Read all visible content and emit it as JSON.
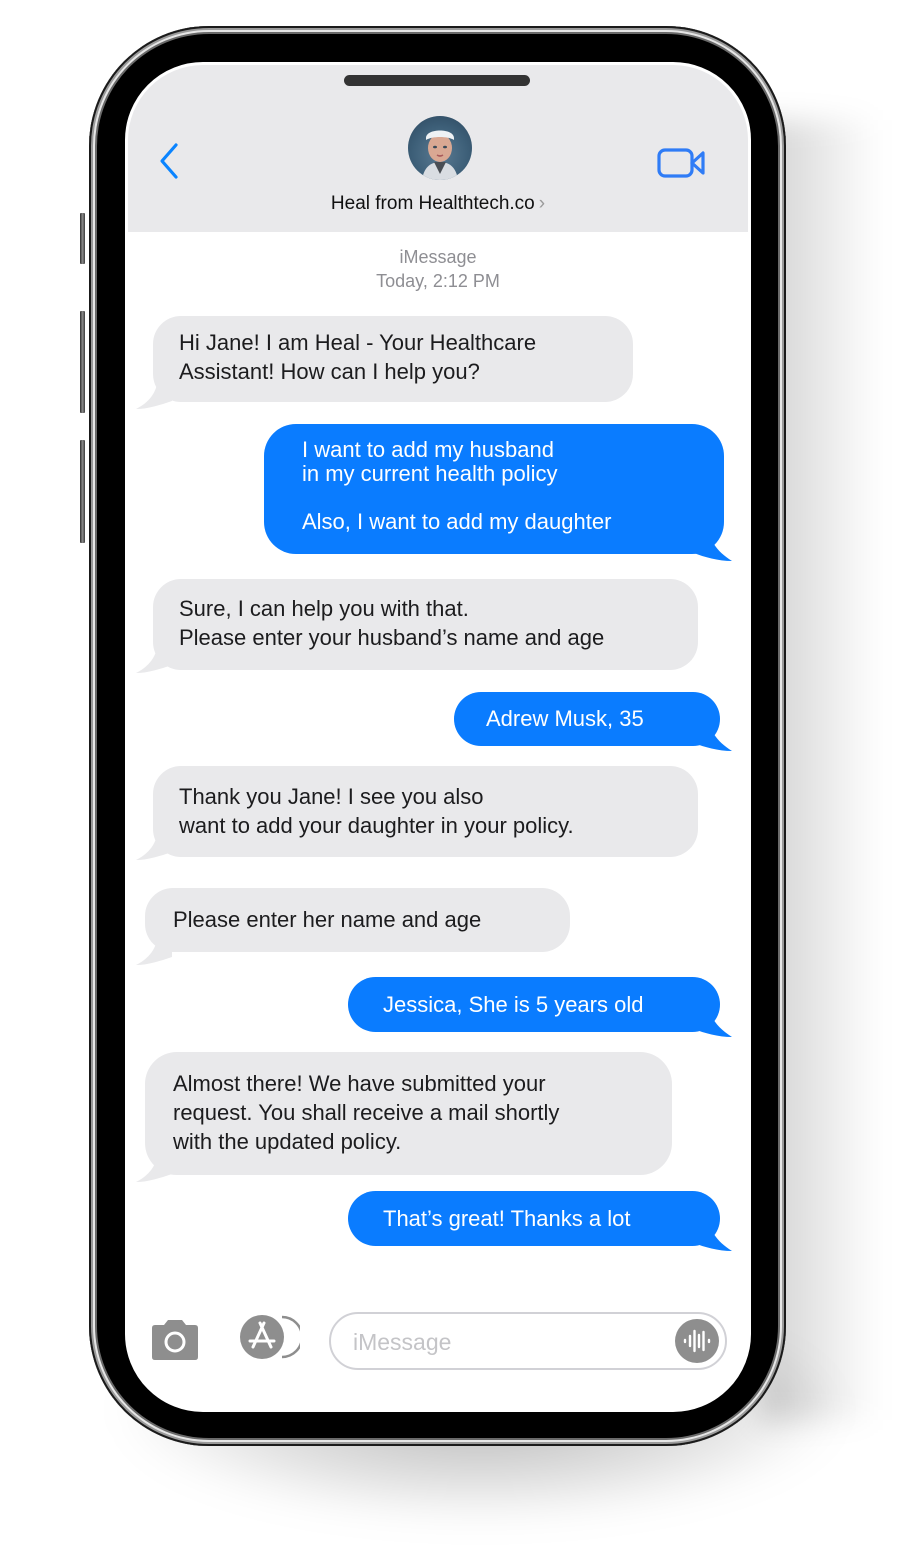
{
  "header": {
    "back_icon": "chevron-left-icon",
    "contact_name": "Heal from Healthtech.co",
    "contact_chevron": "›",
    "video_icon": "video-camera-icon"
  },
  "thread": {
    "service": "iMessage",
    "timestamp": "Today, 2:12 PM"
  },
  "messages": [
    {
      "from": "assistant",
      "text": "Hi Jane! I am Heal - Your Healthcare\nAssistant! How can I help you?"
    },
    {
      "from": "user",
      "text": "I want to add my husband\nin my current health policy\n\nAlso, I want to add my daughter"
    },
    {
      "from": "assistant",
      "text": "Sure, I can help you with that.\nPlease enter your husband’s name and age"
    },
    {
      "from": "user",
      "text": "Adrew Musk, 35"
    },
    {
      "from": "assistant",
      "text": "Thank you Jane! I see you also\nwant to add your daughter in your policy."
    },
    {
      "from": "assistant",
      "text": "Please enter her name and age"
    },
    {
      "from": "user",
      "text": "Jessica, She is 5 years old"
    },
    {
      "from": "assistant",
      "text": "Almost there! We have submitted your\nrequest. You shall receive a mail shortly\nwith the updated policy."
    },
    {
      "from": "user",
      "text": "That’s great! Thanks a lot"
    }
  ],
  "composer": {
    "camera_icon": "camera-icon",
    "apps_icon": "app-store-icon",
    "placeholder": "iMessage",
    "value": "",
    "audio_icon": "audio-waveform-icon"
  },
  "colors": {
    "outgoing_bubble": "#0a7cff",
    "incoming_bubble": "#e9e9eb",
    "accent": "#0a84ff",
    "header_bg": "#e9e9eb"
  }
}
